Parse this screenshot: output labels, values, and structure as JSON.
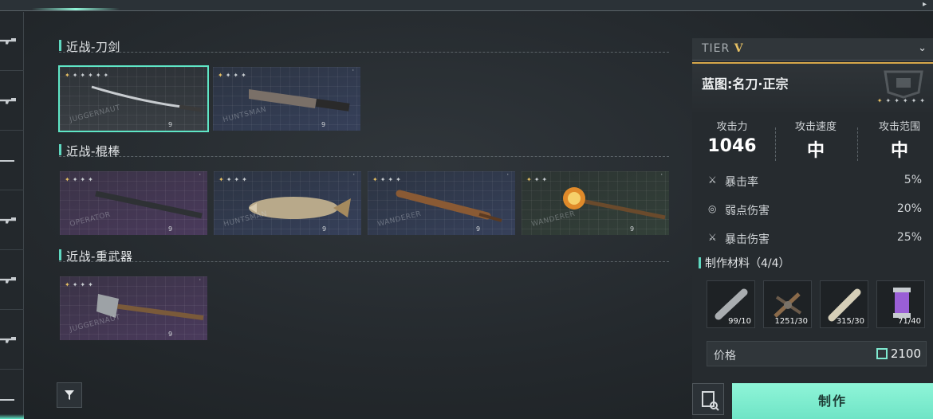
{
  "sections": [
    {
      "title": "近战-刀剑",
      "cards": [
        {
          "brand": "JUGGERNAUT",
          "level": "9",
          "stars": 6,
          "gold": 1,
          "selected": true,
          "theme": "dark"
        },
        {
          "brand": "HUNTSMAN",
          "level": "9",
          "stars": 4,
          "gold": 1,
          "selected": false,
          "theme": "blue"
        }
      ]
    },
    {
      "title": "近战-棍棒",
      "cards": [
        {
          "brand": "OPERATOR",
          "level": "9",
          "stars": 4,
          "gold": 1,
          "selected": false,
          "theme": "purple"
        },
        {
          "brand": "HUNTSMAN",
          "level": "9",
          "stars": 4,
          "gold": 1,
          "selected": false,
          "theme": "blue"
        },
        {
          "brand": "WANDERER",
          "level": "9",
          "stars": 4,
          "gold": 1,
          "selected": false,
          "theme": "blue"
        },
        {
          "brand": "WANDERER",
          "level": "9",
          "stars": 3,
          "gold": 1,
          "selected": false,
          "theme": "green"
        }
      ]
    },
    {
      "title": "近战-重武器",
      "cards": [
        {
          "brand": "JUGGERNAUT",
          "level": "9",
          "stars": 4,
          "gold": 1,
          "selected": false,
          "theme": "purple"
        }
      ]
    }
  ],
  "panel": {
    "tier_label": "TIER",
    "tier_value": "V",
    "blueprint_name": "蓝图:名刀·正宗",
    "stats": [
      {
        "label": "攻击力",
        "value": "1046"
      },
      {
        "label": "攻击速度",
        "value": "中"
      },
      {
        "label": "攻击范围",
        "value": "中"
      }
    ],
    "sub_stats": [
      {
        "icon": "crit-rate-icon",
        "label": "暴击率",
        "value": "5%"
      },
      {
        "icon": "weakspot-icon",
        "label": "弱点伤害",
        "value": "20%"
      },
      {
        "icon": "crit-damage-icon",
        "label": "暴击伤害",
        "value": "25%"
      }
    ],
    "materials_title": "制作材料（4/4）",
    "materials": [
      {
        "name": "steel-rod",
        "count": "99/10"
      },
      {
        "name": "scrap-parts",
        "count": "1251/30"
      },
      {
        "name": "wood-plank",
        "count": "315/30"
      },
      {
        "name": "purple-crystal-vial",
        "count": "71/40"
      }
    ],
    "price_label": "价格",
    "price_value": "2100",
    "craft_label": "制作"
  },
  "colors": {
    "accent": "#5fe6c6",
    "gold": "#e6c064",
    "craft_button": "#7feccf"
  }
}
